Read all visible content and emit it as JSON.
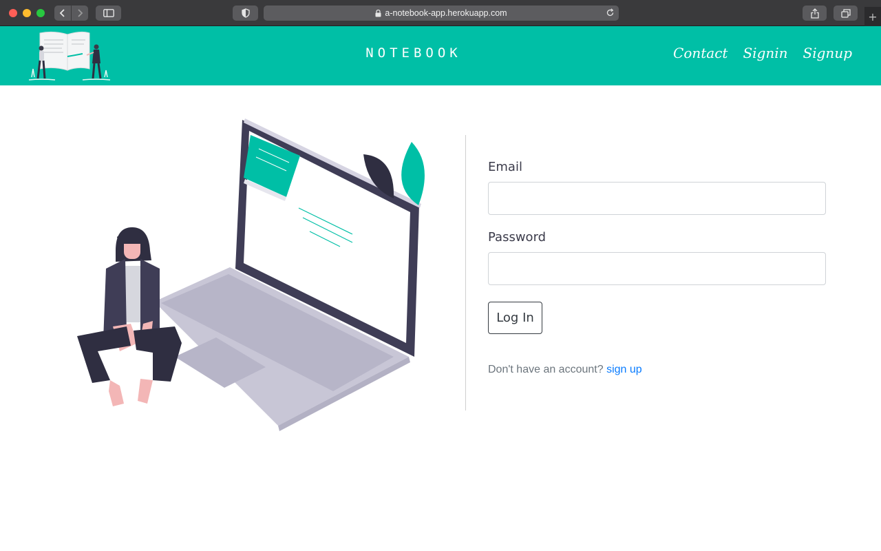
{
  "browser": {
    "url": "a-notebook-app.herokuapp.com",
    "icons": [
      "back-icon",
      "forward-icon",
      "sidebar-icon",
      "shield-icon",
      "lock-icon",
      "reload-icon",
      "share-icon",
      "tabs-icon",
      "plus-icon"
    ]
  },
  "header": {
    "brand": "NOTEBOOK",
    "nav": [
      {
        "label": "Contact"
      },
      {
        "label": "Signin"
      },
      {
        "label": "Signup"
      }
    ],
    "accent_color": "#00bfa6"
  },
  "form": {
    "email_label": "Email",
    "email_value": "",
    "password_label": "Password",
    "password_value": "",
    "login_label": "Log In",
    "signup_prompt": "Don't have an account?",
    "signup_link": "sign up"
  }
}
